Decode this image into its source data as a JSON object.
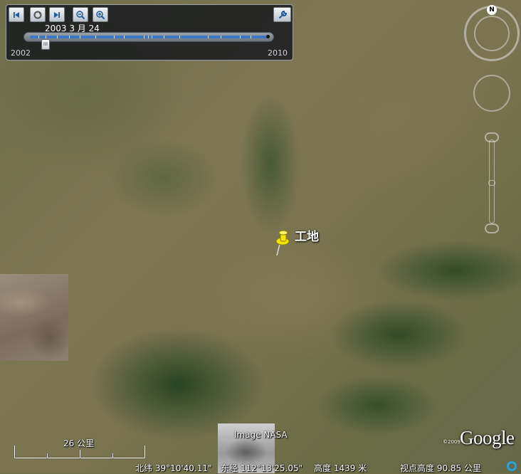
{
  "timeline": {
    "date": "2003 3 月 24",
    "start_year": "2002",
    "end_year": "2010",
    "position_fraction": 0.08
  },
  "map": {
    "placemark_label": "工地",
    "imagery_credit": "Image NASA",
    "logo": "Google",
    "copyright": "©2009"
  },
  "scale": {
    "label": "26 公里"
  },
  "status": {
    "latitude": "北纬  39°10'40.11\"",
    "longitude": "东经 112°13'25.05\"",
    "elevation": "高度 1439 米",
    "eye_altitude": "视点高度    90.85 公里"
  },
  "compass": {
    "north": "N"
  },
  "icons": [
    "skip-back-icon",
    "tour-icon",
    "skip-forward-icon",
    "zoom-out-icon",
    "zoom-in-icon",
    "wrench-icon",
    "pushpin-icon",
    "streaming-icon"
  ],
  "colors": {
    "slider_fill": "#3b79c8",
    "pin": "#f5e40a",
    "streaming": "#27a3d8"
  }
}
